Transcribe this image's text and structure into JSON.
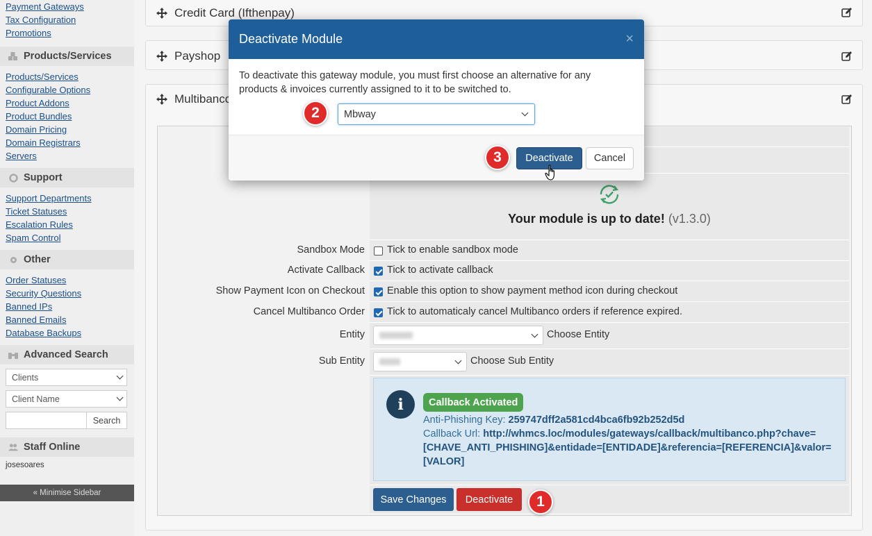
{
  "sidebar": {
    "top_links": [
      "Payment Gateways",
      "Tax Configuration",
      "Promotions"
    ],
    "sections": [
      {
        "title": "Products/Services",
        "links": [
          "Products/Services",
          "Configurable Options",
          "Product Addons",
          "Product Bundles",
          "Domain Pricing",
          "Domain Registrars",
          "Servers"
        ]
      },
      {
        "title": "Support",
        "links": [
          "Support Departments",
          "Ticket Statuses",
          "Escalation Rules",
          "Spam Control"
        ]
      },
      {
        "title": "Other",
        "links": [
          "Order Statuses",
          "Security Questions",
          "Banned IPs",
          "Banned Emails",
          "Database Backups"
        ]
      }
    ],
    "advanced_search": {
      "title": "Advanced Search",
      "select1": "Clients",
      "select2": "Client Name",
      "search_button": "Search"
    },
    "staff_online": {
      "title": "Staff Online",
      "user": "josesoares"
    },
    "minimise": "« Minimise Sidebar"
  },
  "panels": {
    "credit_card": "Credit Card (Ifthenpay)",
    "payshop": "Payshop",
    "multibanco": "Multibanco"
  },
  "module": {
    "status_text": "Your module is up to date!",
    "version": "(v1.3.0)",
    "fields": {
      "sandbox": {
        "label": "Sandbox Mode",
        "text": "Tick to enable sandbox mode",
        "checked": false
      },
      "callback": {
        "label": "Activate Callback",
        "text": "Tick to activate callback",
        "checked": true
      },
      "payment_icon": {
        "label": "Show Payment Icon on Checkout",
        "text": "Enable this option to show payment method icon during checkout",
        "checked": true
      },
      "cancel_order": {
        "label": "Cancel Multibanco Order",
        "text": "Tick to automaticaly cancel Multibanco orders if reference expired.",
        "checked": true
      },
      "entity": {
        "label": "Entity",
        "help": "Choose Entity"
      },
      "sub_entity": {
        "label": "Sub Entity",
        "help": "Choose Sub Entity"
      }
    },
    "info": {
      "badge": "Callback Activated",
      "key_label": "Anti-Phishing Key:",
      "key_value": "259747dff2a581cd4bca6fb92b252d5d",
      "url_label": "Callback Url:",
      "url_line1": "http://whmcs.loc/modules/gateways/callback/multibanco.php?chave=",
      "url_line2": "[CHAVE_ANTI_PHISHING]&entidade=[ENTIDADE]&referencia=[REFERENCIA]&valor=",
      "url_line3": "[VALOR]"
    },
    "save_button": "Save Changes",
    "deactivate_button": "Deactivate"
  },
  "modal": {
    "title": "Deactivate Module",
    "close": "×",
    "body_line1": "To deactivate this gateway module, you must first choose an alternative for any",
    "body_line2": "products & invoices currently assigned to it to be switched to.",
    "selected_gateway": "Mbway",
    "deactivate_button": "Deactivate",
    "cancel_button": "Cancel"
  },
  "steps": [
    "1",
    "2",
    "3"
  ],
  "colors": {
    "header_blue": "#1f5f99",
    "primary_btn": "#2c5e8f",
    "danger_btn": "#c9302c",
    "step_red": "#e02b2b",
    "badge_green": "#4ea34e",
    "link": "#1a4f8a"
  }
}
